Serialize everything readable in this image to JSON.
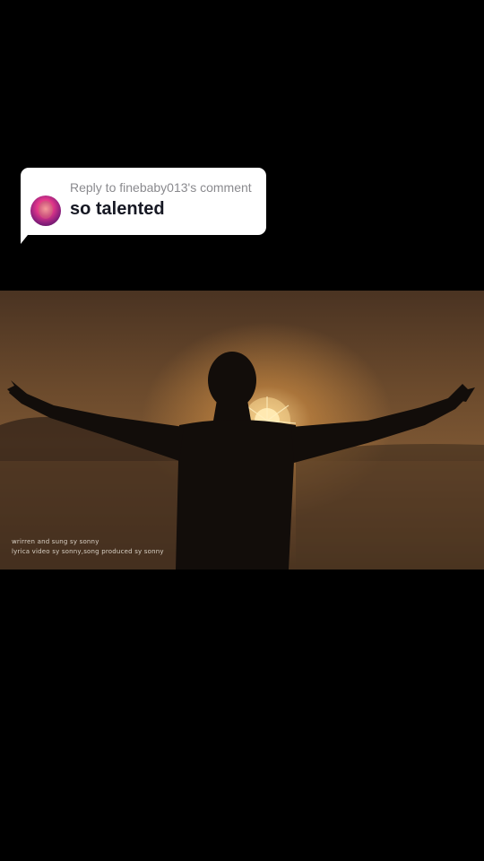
{
  "reply": {
    "reply_to": "Reply to finebaby013's comment",
    "comment_text": "so talented"
  },
  "video": {
    "credit_line_1": "wrirren and sung sy sonny",
    "credit_line_2": "lyrica video sy sonny,song produced sy sonny"
  },
  "colors": {
    "background": "#000000",
    "bubble": "#ffffff",
    "reply_to_text": "#8a8a8e",
    "comment_text": "#161823"
  }
}
